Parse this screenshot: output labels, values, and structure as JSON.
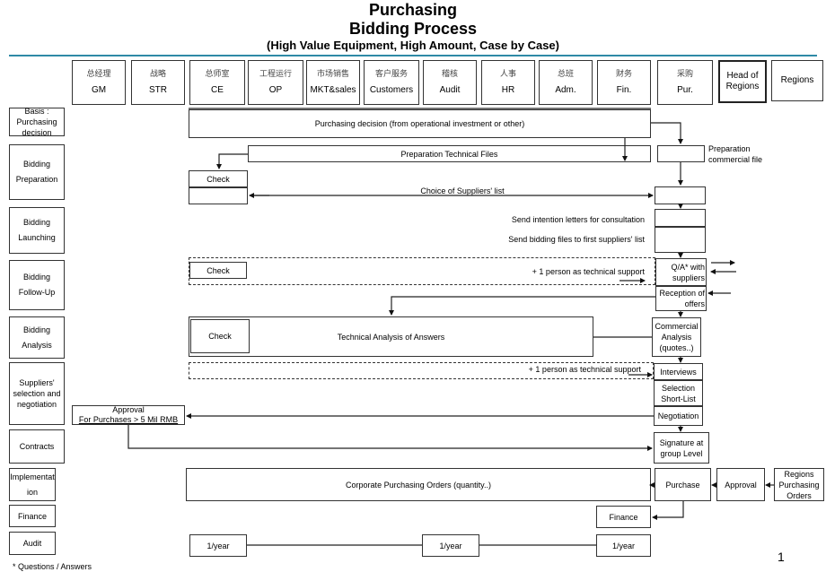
{
  "title": {
    "line1": "Purchasing",
    "line2": "Bidding Process",
    "line3": "(High Value Equipment, High Amount, Case by Case)"
  },
  "departments": [
    {
      "cn": "总经理",
      "en": "GM"
    },
    {
      "cn": "战略",
      "en": "STR"
    },
    {
      "cn": "总师室",
      "en": "CE"
    },
    {
      "cn": "工程运行",
      "en": "OP"
    },
    {
      "cn": "市场销售",
      "en": "MKT&sales"
    },
    {
      "cn": "客户服务",
      "en": "Customers"
    },
    {
      "cn": "稽核",
      "en": "Audit"
    },
    {
      "cn": "人事",
      "en": "HR"
    },
    {
      "cn": "总班",
      "en": "Adm."
    },
    {
      "cn": "财务",
      "en": "Fin."
    },
    {
      "cn": "采购",
      "en": "Pur."
    },
    {
      "cn": "",
      "en": "Head of Regions"
    },
    {
      "cn": "",
      "en": "Regions"
    }
  ],
  "phases": [
    "Basis : Purchasing decision",
    "Bidding Preparation",
    "Bidding Launching",
    "Bidding Follow-Up",
    "Bidding Analysis",
    "Suppliers' selection and negotiation",
    "Contracts",
    "Implementation",
    "Finance",
    "Audit"
  ],
  "steps": {
    "purchasing_decision": "Purchasing decision (from operational investment or other)",
    "prep_technical_files": "Preparation Technical Files",
    "prep_commercial_file": "Preparation commercial file",
    "check": "Check",
    "choice_suppliers": "Choice of Suppliers' list",
    "send_intention": "Send intention letters for consultation",
    "send_bidding": "Send bidding files to first suppliers' list",
    "tech_support": "+ 1 person as technical support",
    "qa_suppliers": "Q/A* with suppliers",
    "reception_offers": "Reception of offers",
    "tech_analysis": "Technical Analysis of Answers",
    "commercial_analysis": "Commercial Analysis (quotes..)",
    "interviews": "Interviews",
    "selection_shortlist": "Selection Short-List",
    "negotiation": "Negotiation",
    "approval_gm_line1": "Approval",
    "approval_gm_line2": "For Purchases > 5 Mil RMB",
    "signature": "Signature at group Level",
    "corporate_orders": "Corporate Purchasing Orders (quantity..)",
    "purchase": "Purchase",
    "approval": "Approval",
    "regions_orders": "Regions Purchasing Orders",
    "finance": "Finance",
    "audit_freq": "1/year"
  },
  "footnote": "* Questions / Answers",
  "page_number": "1"
}
